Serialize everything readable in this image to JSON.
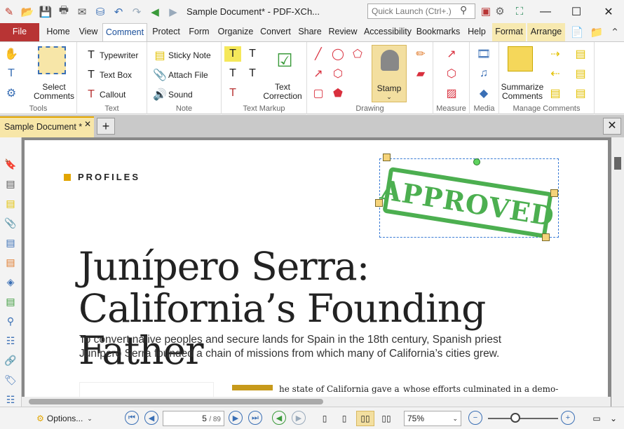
{
  "titlebar": {
    "title": "Sample Document* - PDF-XCh...",
    "quick_launch_placeholder": "Quick Launch (Ctrl+.)"
  },
  "menu": {
    "file": "File",
    "tabs": [
      "Home",
      "View",
      "Comment",
      "Protect",
      "Form",
      "Organize",
      "Convert",
      "Share",
      "Review",
      "Accessibility",
      "Bookmarks",
      "Help",
      "Format",
      "Arrange"
    ],
    "active": "Comment"
  },
  "ribbon": {
    "tools": {
      "label": "Tools",
      "select_comments": "Select\nComments"
    },
    "text": {
      "label": "Text",
      "typewriter": "Typewriter",
      "text_box": "Text Box",
      "callout": "Callout"
    },
    "note": {
      "label": "Note",
      "sticky_note": "Sticky Note",
      "attach_file": "Attach File",
      "sound": "Sound"
    },
    "text_markup": {
      "label": "Text Markup",
      "text_correction": "Text\nCorrection"
    },
    "drawing": {
      "label": "Drawing",
      "stamp": "Stamp"
    },
    "measure": {
      "label": "Measure"
    },
    "media": {
      "label": "Media"
    },
    "manage": {
      "label": "Manage Comments",
      "summarize": "Summarize\nComments"
    }
  },
  "doc_tab": {
    "name": "Sample Document *"
  },
  "page": {
    "section": "PROFILES",
    "headline_line1": "Junípero Serra:",
    "headline_line2": "California’s Founding Father",
    "subhead": "To convert native peoples and secure lands for Spain in the 18th century, Spanish priest Junípero Serra founded a chain of missions from which many of California’s cities grew.",
    "col1_start": "he state of California gave a",
    "col2_start": "whose efforts culminated in a demo-",
    "stamp_text": "APPROVED"
  },
  "statusbar": {
    "options": "Options...",
    "page_current": "5",
    "page_total": "/ 89",
    "zoom": "75%"
  },
  "colors": {
    "file_tab": "#b83434",
    "accent": "#e2a500",
    "stamp_green": "#4caf50",
    "selection": "#3a7bd5"
  }
}
